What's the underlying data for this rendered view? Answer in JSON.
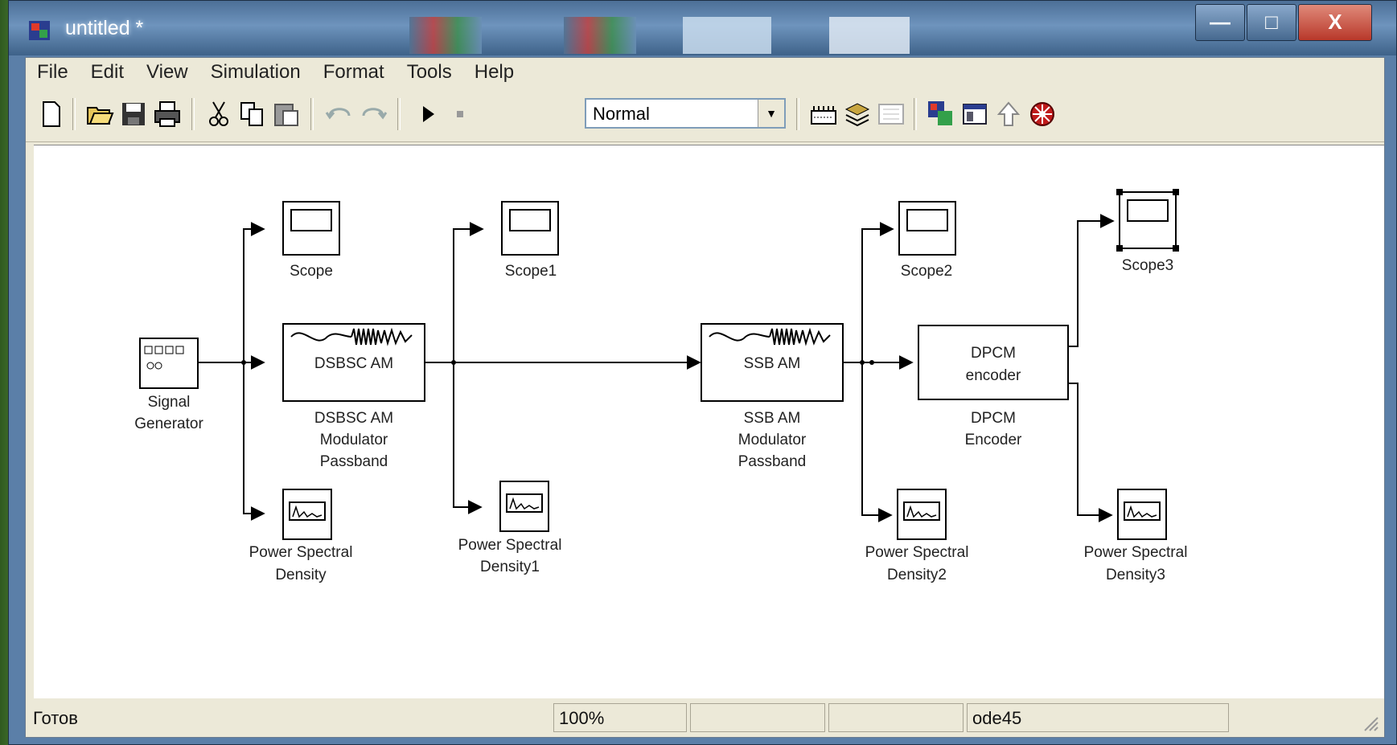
{
  "window": {
    "title": "untitled *",
    "controls": {
      "minimize": "—",
      "maximize": "□",
      "close": "X"
    }
  },
  "menu": [
    "File",
    "Edit",
    "View",
    "Simulation",
    "Format",
    "Tools",
    "Help"
  ],
  "toolbar": {
    "sim_mode": "Normal",
    "icons": [
      "new-icon",
      "open-icon",
      "save-icon",
      "print-icon",
      "cut-icon",
      "copy-icon",
      "paste-icon",
      "undo-icon",
      "redo-icon",
      "start-icon",
      "stop-icon",
      "build-icon",
      "update-icon",
      "debug-icon",
      "library-browser-icon",
      "model-explorer-icon",
      "parent-icon",
      "debugger-icon"
    ]
  },
  "blocks": {
    "signal_generator": {
      "label_line1": "Signal",
      "label_line2": "Generator"
    },
    "scope": "Scope",
    "scope1": "Scope1",
    "scope2": "Scope2",
    "scope3": "Scope3",
    "dsbsc": {
      "inner": "DSBSC AM",
      "label_line1": "DSBSC AM",
      "label_line2": "Modulator",
      "label_line3": "Passband"
    },
    "ssb": {
      "inner": "SSB AM",
      "label_line1": "SSB AM",
      "label_line2": "Modulator",
      "label_line3": "Passband"
    },
    "dpcm": {
      "inner_line1": "DPCM",
      "inner_line2": "encoder",
      "label_line1": "DPCM",
      "label_line2": "Encoder"
    },
    "psd": {
      "line1": "Power Spectral",
      "line2": "Density"
    },
    "psd1": {
      "line1": "Power Spectral",
      "line2": "Density1"
    },
    "psd2": {
      "line1": "Power Spectral",
      "line2": "Density2"
    },
    "psd3": {
      "line1": "Power Spectral",
      "line2": "Density3"
    }
  },
  "status": {
    "ready": "Готов",
    "zoom": "100%",
    "solver": "ode45"
  }
}
